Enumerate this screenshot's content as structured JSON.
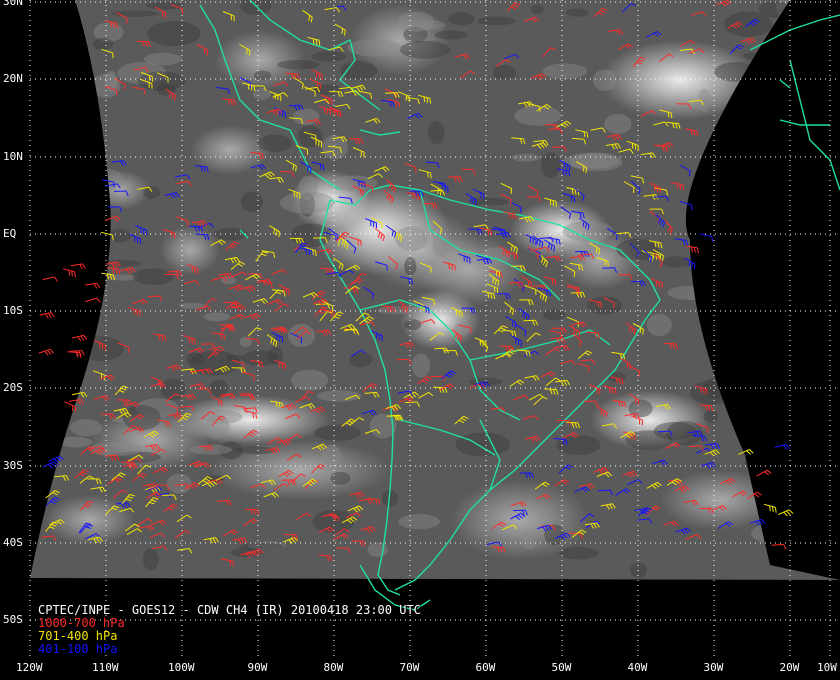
{
  "caption": {
    "title": "CPTEC/INPE - GOES12 - CDW CH4 (IR) 20100418 23:00 UTC",
    "legend": [
      {
        "label": "1000-700 hPa",
        "color": "#ff2a2a"
      },
      {
        "label": "701-400 hPa",
        "color": "#f2e600"
      },
      {
        "label": "401-100 hPa",
        "color": "#1414ff"
      }
    ]
  },
  "latitude_labels": [
    "30N",
    "20N",
    "10N",
    "EQ",
    "10S",
    "20S",
    "30S",
    "40S",
    "50S"
  ],
  "longitude_labels": [
    "120W",
    "110W",
    "100W",
    "90W",
    "80W",
    "70W",
    "60W",
    "50W",
    "40W",
    "30W",
    "20W",
    "10W"
  ],
  "colors": {
    "coastline": "#1fe0a0",
    "grid": "#ffffff",
    "background": "#000000"
  }
}
